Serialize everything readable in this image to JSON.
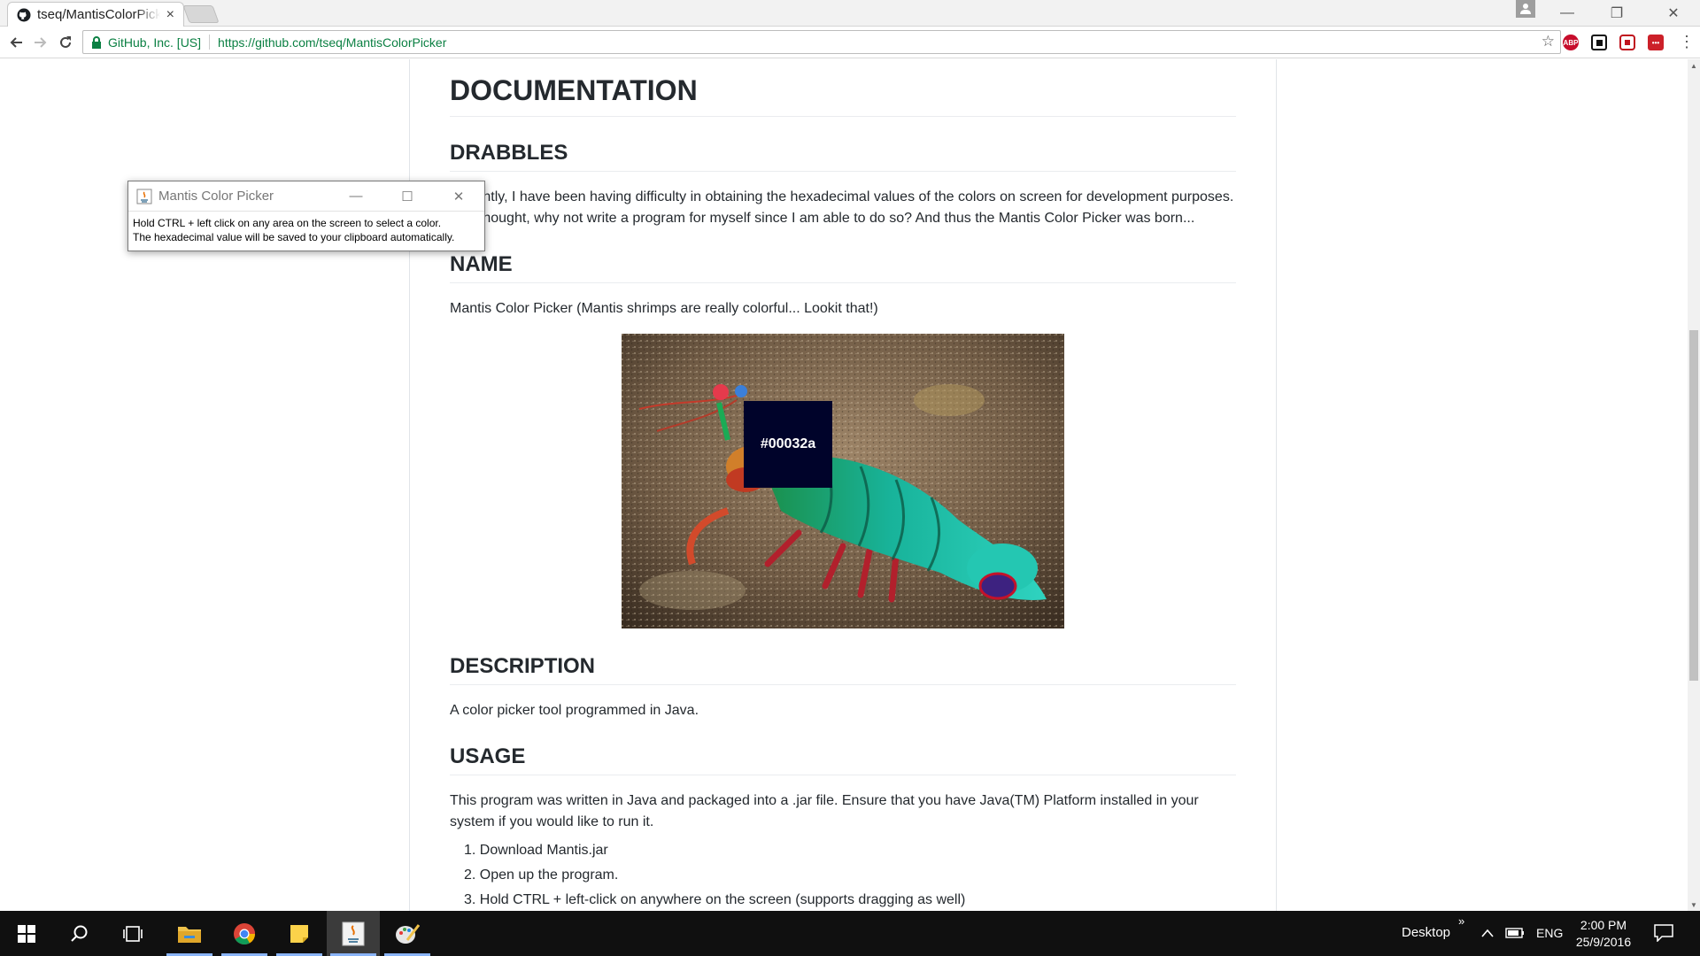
{
  "browser": {
    "tab_title": "tseq/MantisColorPicker",
    "tab_close": "×",
    "security_label": "GitHub, Inc. [US]",
    "url": "https://github.com/tseq/MantisColorPicker",
    "star_icon": "☆",
    "extensions": [
      {
        "name": "adblock-plus",
        "label": "ABP",
        "color": "#c70d2c"
      },
      {
        "name": "pocket",
        "label": "",
        "color": "#111111"
      },
      {
        "name": "office-ext",
        "label": "",
        "color": "#c0141e"
      },
      {
        "name": "lastpass",
        "label": "•••",
        "color": "#cc2029"
      }
    ],
    "window_controls": {
      "minimize": "—",
      "restore": "❐",
      "close": "✕"
    }
  },
  "readme": {
    "h_documentation": "DOCUMENTATION",
    "h_drabbles": "DRABBLES",
    "drabbles_text": "Recently, I have been having difficulty in obtaining the hexadecimal values of the colors on screen for development purposes. So I thought, why not write a program for myself since I am able to do so? And thus the Mantis Color Picker was born...",
    "h_name": "NAME",
    "name_text": "Mantis Color Picker (Mantis shrimps are really colorful... Lookit that!)",
    "swatch_hex": "#00032a",
    "swatch_color": "#00032a",
    "h_description": "DESCRIPTION",
    "description_text": "A color picker tool programmed in Java.",
    "h_usage": "USAGE",
    "usage_text": "This program was written in Java and packaged into a .jar file. Ensure that you have Java(TM) Platform installed in your system if you would like to run it.",
    "usage_steps": [
      "1. Download Mantis.jar",
      "2. Open up the program.",
      "3. Hold CTRL + left-click on anywhere on the screen (supports dragging as well)"
    ]
  },
  "picker_window": {
    "title": "Mantis Color Picker",
    "instructions_line1": "Hold CTRL + left click on any area on the screen to select a color.",
    "instructions_line2": "The hexadecimal value will be saved to your clipboard automatically.",
    "controls": {
      "minimize": "—",
      "maximize": "☐",
      "close": "✕"
    }
  },
  "taskbar": {
    "desktop_label": "Desktop",
    "chevron": "»",
    "language": "ENG",
    "time": "2:00 PM",
    "date": "25/9/2016"
  },
  "colors": {
    "secure_green": "#0b8043",
    "taskbar_bg": "#101010",
    "heading_text": "#24292e"
  }
}
